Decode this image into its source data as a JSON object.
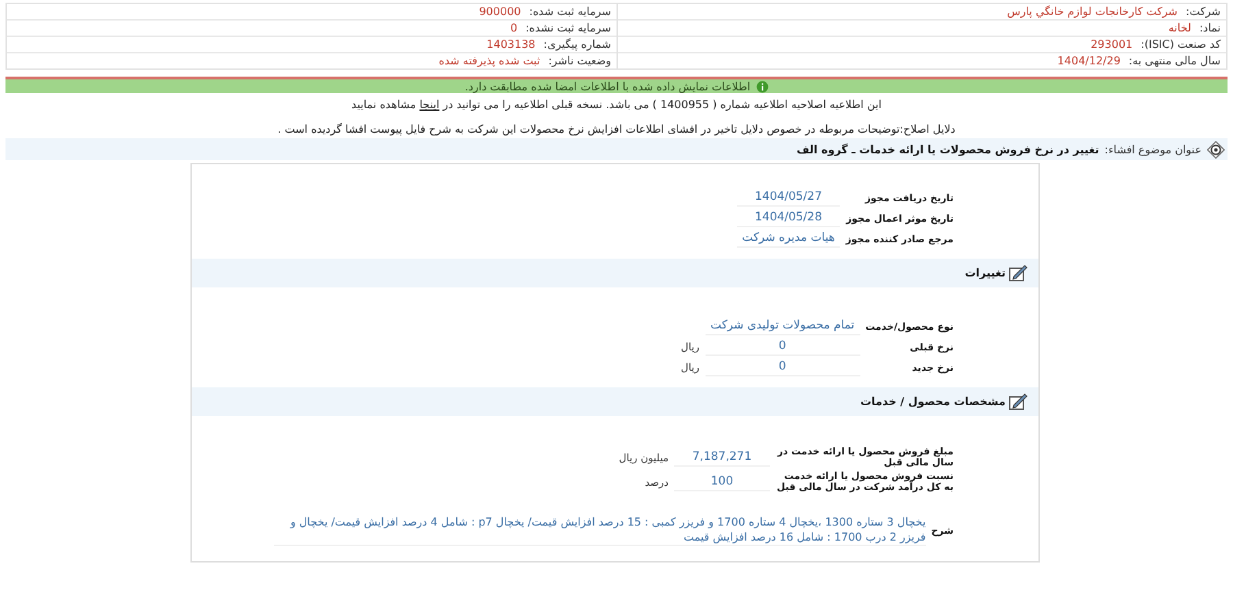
{
  "company_info": {
    "right": [
      {
        "label": "شرکت:",
        "value": "شرکت کارخانجات لوازم خانگي پارس"
      },
      {
        "label": "نماد:",
        "value": "لخانه"
      },
      {
        "label": "کد صنعت (ISIC):",
        "value": "293001"
      },
      {
        "label": "سال مالی منتهی به:",
        "value": "1404/12/29"
      }
    ],
    "left": [
      {
        "label": "سرمایه ثبت شده:",
        "value": "900000"
      },
      {
        "label": "سرمایه ثبت نشده:",
        "value": "0"
      },
      {
        "label": "شماره پیگیری:",
        "value": "1403138"
      },
      {
        "label": "وضعیت ناشر:",
        "value": "ثبت شده پذیرفته شده"
      }
    ]
  },
  "verification_notice": "اطلاعات نمایش داده شده با اطلاعات امضا شده مطابقت دارد.",
  "correction_notice": {
    "before": "این اطلاعیه اصلاحیه اطلاعیه شماره ( 1400955 ) می باشد. نسخه قبلی اطلاعیه را می توانید در",
    "link": "اینجا",
    "after": "مشاهده نمایید"
  },
  "correction_reason": "دلایل اصلاح:توضیحات مربوطه در خصوص دلایل تاخیر در افشای اطلاعات افزایش نرخ محصولات این شرکت به شرح فایل پیوست افشا گردیده است .",
  "subject": {
    "label": "عنوان موضوع افشاء:",
    "value": "تغییر در نرخ فروش محصولات یا ارائه خدمات ـ گروه الف"
  },
  "permit_fields": [
    {
      "label": "تاریخ دریافت مجوز",
      "value": "1404/05/27"
    },
    {
      "label": "تاریخ موثر اعمال مجوز",
      "value": "1404/05/28"
    },
    {
      "label": "مرجع صادر کننده مجوز",
      "value": "هیات مدیره شرکت"
    }
  ],
  "sections": [
    {
      "title": "تغییرات",
      "rows": [
        {
          "kind": "field",
          "label": "نوع محصول/خدمت",
          "value": "تمام محصولات تولیدی شرکت"
        },
        {
          "kind": "field",
          "label": "نرخ قبلی",
          "value": "0",
          "unit": "ریال"
        },
        {
          "kind": "field",
          "label": "نرخ جدید",
          "value": "0",
          "unit": "ریال"
        }
      ]
    },
    {
      "title": "مشخصات محصول / خدمات",
      "rows": [
        {
          "kind": "field",
          "label": "مبلغ فروش محصول یا ارائه خدمت در سال مالی قبل",
          "value": "7,187,271",
          "unit": "میلیون ریال"
        },
        {
          "kind": "field",
          "label": "نسبت فروش محصول یا ارائه خدمت به کل درآمد شرکت در سال مالی قبل",
          "value": "100",
          "unit": "درصد"
        },
        {
          "kind": "description",
          "label": "شرح",
          "value": "یخچال 3 ستاره 1300 ،یخچال 4 ستاره 1700 و فریزر کمبی : 15 درصد افزایش قیمت/ یخچال p7 : شامل 4 درصد افزایش قیمت/ یخچال و فریزر 2 درب 1700 : شامل 16 درصد افزایش قیمت"
        }
      ]
    }
  ]
}
